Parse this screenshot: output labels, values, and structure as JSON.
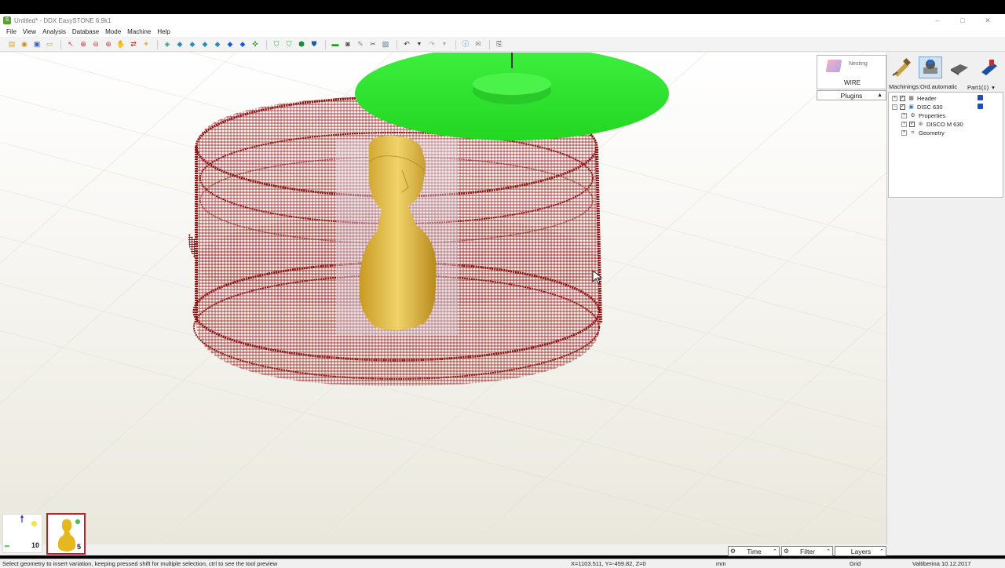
{
  "window": {
    "title": "Untitled* - DDX EasySTONE 6.9k1",
    "app_icon_text": "S",
    "controls": [
      "–",
      "□",
      "✕"
    ]
  },
  "menu": [
    "File",
    "View",
    "Analysis",
    "Database",
    "Mode",
    "Machine",
    "Help"
  ],
  "toolbar": {
    "icons": [
      "open-icon",
      "refresh-icon",
      "save-icon",
      "print-icon",
      "select-icon",
      "zoom-window-icon",
      "zoom-out-icon",
      "zoom-in-icon",
      "pan-icon",
      "rotate-icon",
      "light-icon",
      "view-iso-icon",
      "view-front-icon",
      "view-back-icon",
      "view-left-icon",
      "view-right-icon",
      "view-top-icon",
      "view-bottom-icon",
      "shade-icon",
      "wire-icon",
      "solid-icon",
      "shield-icon",
      "rect-icon",
      "camera-icon",
      "cut-icon",
      "tool-icon",
      "sheet-icon",
      "undo-icon",
      "redo-icon",
      "info-icon",
      "mail-icon",
      "exit-icon"
    ]
  },
  "nesting": {
    "label": "Nesting",
    "mode": "WIRE"
  },
  "plugins": {
    "label": "Plugins"
  },
  "machinings": {
    "label": "Machinings:Ord.automatic",
    "part": "Part1(1)"
  },
  "tree": {
    "items": [
      {
        "label": "Header",
        "level": 0,
        "expander": "+",
        "checked": true
      },
      {
        "label": "DISC 630",
        "level": 0,
        "expander": "−",
        "checked": true
      },
      {
        "label": "Properties",
        "level": 1,
        "expander": "+",
        "checked": false
      },
      {
        "label": "DISCO M 630",
        "level": 1,
        "expander": "+",
        "checked": true
      },
      {
        "label": "Geometry",
        "level": 1,
        "expander": "+",
        "checked": false
      }
    ]
  },
  "thumbnails": [
    {
      "count": "10",
      "selected": false
    },
    {
      "count": "5",
      "selected": true
    }
  ],
  "bottom_buttons": {
    "time": "Time",
    "filter": "Filter",
    "layers": "Layers"
  },
  "status": {
    "message": "Select geometry to insert variation, keeping pressed shift for multiple selection, ctrl to see the tool preview",
    "coords": "X=1103.511, Y=-459.82, Z=0",
    "unit": "mm",
    "grid": "Grid",
    "user_date": "Valtiberina 10.12.2017"
  },
  "colors": {
    "wire": "#9b1b1b",
    "tool_disc": "#33ee33",
    "bust": "#e6c64a",
    "selection_border": "#c81e2c"
  }
}
